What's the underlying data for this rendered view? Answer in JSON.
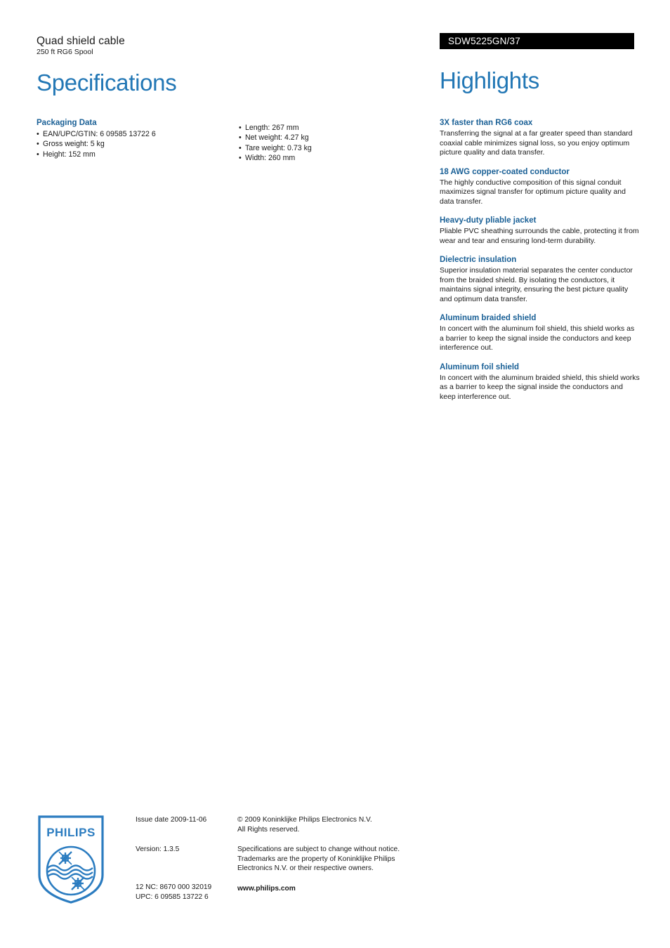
{
  "document": {
    "product_name": "Quad shield cable",
    "product_subtitle": "250 ft RG6 Spool",
    "left_section_title": "Specifications",
    "right_section_title": "Highlights",
    "product_code": "SDW5225GN/37"
  },
  "colors": {
    "heading_blue": "#2277b5",
    "bold_blue": "#1a6096",
    "badge_bg": "#000000",
    "badge_text": "#ffffff",
    "logo_blue": "#2b7cc0",
    "body_text": "#1a1a1a"
  },
  "specifications": {
    "group_heading": "Packaging Data",
    "column_left": [
      "EAN/UPC/GTIN: 6 09585 13722 6",
      "Gross weight: 5 kg",
      "Height: 152 mm"
    ],
    "column_right": [
      "Length: 267 mm",
      "Net weight: 4.27 kg",
      "Tare weight: 0.73 kg",
      "Width: 260 mm"
    ]
  },
  "highlights": [
    {
      "title": "3X faster than RG6 coax",
      "body": "Transferring the signal at a far greater speed than standard coaxial cable minimizes signal loss, so you enjoy optimum picture quality and data transfer."
    },
    {
      "title": "18 AWG copper-coated conductor",
      "body": "The highly conductive composition of this signal conduit maximizes signal transfer for optimum picture quality and data transfer."
    },
    {
      "title": "Heavy-duty pliable jacket",
      "body": "Pliable PVC sheathing surrounds the cable, protecting it from wear and tear and ensuring lond-term durability."
    },
    {
      "title": "Dielectric insulation",
      "body": "Superior insulation material separates the center conductor from the braided shield. By isolating the conductors, it maintains signal integrity, ensuring the best picture quality and optimum data transfer."
    },
    {
      "title": "Aluminum braided shield",
      "body": "In concert with the aluminum foil shield, this shield works as a barrier to keep the signal inside the conductors and keep interference out."
    },
    {
      "title": "Aluminum foil shield",
      "body": "In concert with the aluminum braided shield, this shield works as a barrier to keep the signal inside the conductors and keep interference out."
    }
  ],
  "footer": {
    "logo_wordmark": "PHILIPS",
    "issue_date": "Issue date 2009-11-06",
    "version": "Version: 1.3.5",
    "nc_code": "12 NC: 8670 000 32019",
    "upc_code": "UPC: 6 09585 13722 6",
    "copyright_line1": "© 2009 Koninklijke Philips Electronics N.V.",
    "copyright_line2": "All Rights reserved.",
    "disclaimer_line1": "Specifications are subject to change without notice.",
    "disclaimer_line2": "Trademarks are the property of Koninklijke Philips",
    "disclaimer_line3": "Electronics N.V. or their respective owners.",
    "website": "www.philips.com"
  }
}
